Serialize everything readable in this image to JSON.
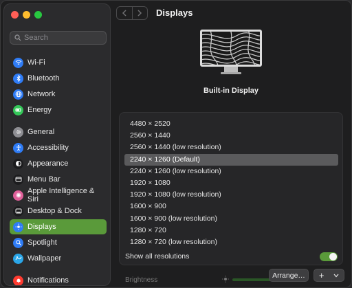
{
  "window": {
    "title": "Displays"
  },
  "search": {
    "placeholder": "Search"
  },
  "sidebar": {
    "items": [
      {
        "label": "Wi-Fi",
        "icon": "wifi-icon",
        "color": "#2f7cf6"
      },
      {
        "label": "Bluetooth",
        "icon": "bluetooth-icon",
        "color": "#2f7cf6"
      },
      {
        "label": "Network",
        "icon": "globe-icon",
        "color": "#2f7cf6"
      },
      {
        "label": "Energy",
        "icon": "battery-icon",
        "color": "#34c759"
      },
      {
        "label": "General",
        "icon": "gear-icon",
        "color": "#8e8e93"
      },
      {
        "label": "Accessibility",
        "icon": "accessibility-icon",
        "color": "#2f7cf6"
      },
      {
        "label": "Appearance",
        "icon": "appearance-icon",
        "color": "#1c1c1e"
      },
      {
        "label": "Menu Bar",
        "icon": "menubar-icon",
        "color": "#1c1c1e"
      },
      {
        "label": "Apple Intelligence & Siri",
        "icon": "siri-icon",
        "color": "#e0609a"
      },
      {
        "label": "Desktop & Dock",
        "icon": "dock-icon",
        "color": "#1c1c1e"
      },
      {
        "label": "Displays",
        "icon": "sun-icon",
        "color": "#2f7cf6",
        "selected": true
      },
      {
        "label": "Spotlight",
        "icon": "magnifier-icon",
        "color": "#2f7cf6"
      },
      {
        "label": "Wallpaper",
        "icon": "wallpaper-icon",
        "color": "#2aa6e8"
      },
      {
        "label": "Notifications",
        "icon": "bell-icon",
        "color": "#ff3b30"
      }
    ]
  },
  "display": {
    "name": "Built-in Display"
  },
  "resolutions": {
    "items": [
      {
        "label": "4480 × 2520"
      },
      {
        "label": "2560 × 1440"
      },
      {
        "label": "2560 × 1440 (low resolution)"
      },
      {
        "label": "2240 × 1260 (Default)",
        "selected": true
      },
      {
        "label": "2240 × 1260 (low resolution)"
      },
      {
        "label": "1920 × 1080"
      },
      {
        "label": "1920 × 1080 (low resolution)"
      },
      {
        "label": "1600 × 900"
      },
      {
        "label": "1600 × 900 (low resolution)"
      },
      {
        "label": "1280 × 720"
      },
      {
        "label": "1280 × 720 (low resolution)"
      }
    ],
    "show_all_label": "Show all resolutions",
    "show_all_enabled": true
  },
  "brightness": {
    "label": "Brightness"
  },
  "footer": {
    "arrange_label": "Arrange…",
    "add_label": "+"
  },
  "colors": {
    "accent": "#5a9a3a",
    "selection": "#5a5a5c"
  }
}
